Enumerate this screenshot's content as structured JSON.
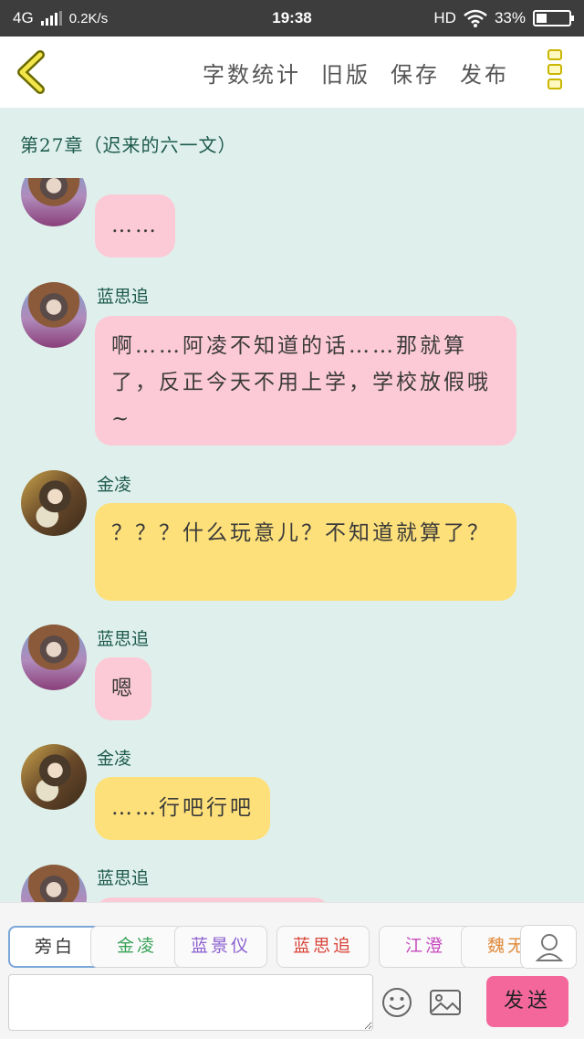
{
  "status_bar": {
    "network": "4G",
    "speed": "0.2K/s",
    "time": "19:38",
    "hd": "HD",
    "battery": "33%",
    "battery_level": 0.33
  },
  "toolbar": {
    "actions": [
      "字数统计",
      "旧版",
      "保存",
      "发布"
    ],
    "back_icon": "chevron-left-icon",
    "menu_icon": "more-vertical-icon",
    "accent": "#c9b600"
  },
  "chapter": {
    "title": "第27章（迟来的六一文）"
  },
  "messages": [
    {
      "speaker": "",
      "text": "……",
      "color": "pink"
    },
    {
      "speaker": "蓝思追",
      "text": "啊……阿凌不知道的话……那就算了，反正今天不用上学，学校放假哦~",
      "color": "pink"
    },
    {
      "speaker": "金凌",
      "text": "？？？什么玩意儿？不知道就算了？",
      "color": "yellow"
    },
    {
      "speaker": "蓝思追",
      "text": "嗯",
      "color": "pink"
    },
    {
      "speaker": "金凌",
      "text": "……行吧行吧",
      "color": "yellow"
    },
    {
      "speaker": "蓝思追",
      "text": "",
      "color": "pink"
    }
  ],
  "characters": [
    {
      "label": "旁白",
      "color": "#333333"
    },
    {
      "label": "金凌",
      "color": "#3aa35a"
    },
    {
      "label": "蓝景仪",
      "color": "#8a5fcf"
    },
    {
      "label": "蓝思追",
      "color": "#d9453a"
    },
    {
      "label": "江澄",
      "color": "#c64bbf"
    },
    {
      "label": "魏无",
      "color": "#e08a3a"
    }
  ],
  "composer": {
    "placeholder": "",
    "value": "",
    "send_label": "发送",
    "send_color": "#f3679b",
    "emoji_icon": "smile-icon",
    "image_icon": "image-icon",
    "profile_icon": "user-icon"
  }
}
